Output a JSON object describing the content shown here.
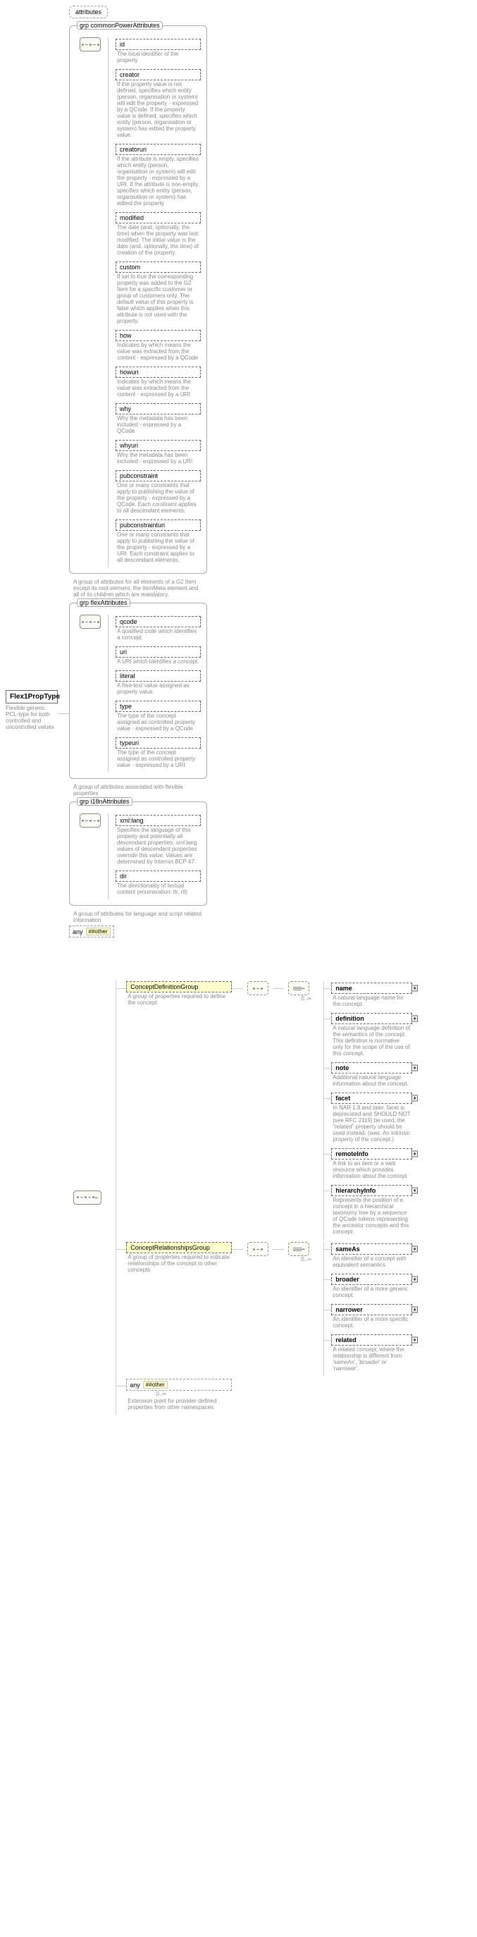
{
  "root": {
    "name": "Flex1PropType",
    "desc": "Flexible generic PCL-type for both controlled and uncontrolled values"
  },
  "attributes_label": "attributes",
  "groups": {
    "common": {
      "title": "grp commonPowerAttributes",
      "desc": "A group of attributes for all elements of a G2 Item except its root element, the itemMeta element and all of its children which are mandatory.",
      "items": [
        {
          "name": "id",
          "desc": "The local identifier of the property."
        },
        {
          "name": "creator",
          "desc": "If the property value is not defined, specifies which entity (person, organisation or system) will edit the property - expressed by a QCode. If the property value is defined, specifies which entity (person, organisation or system) has edited the property value."
        },
        {
          "name": "creatoruri",
          "desc": "If the attribute is empty, specifies which entity (person, organisation or system) will edit the property - expressed by a URI. If the attribute is non-empty, specifies which entity (person, organisation or system) has edited the property."
        },
        {
          "name": "modified",
          "desc": "The date (and, optionally, the time) when the property was last modified. The initial value is the date (and, optionally, the time) of creation of the property."
        },
        {
          "name": "custom",
          "desc": "If set to true the corresponding property was added to the G2 Item for a specific customer or group of customers only. The default value of this property is false which applies when this attribute is not used with the property."
        },
        {
          "name": "how",
          "desc": "Indicates by which means the value was extracted from the content - expressed by a QCode"
        },
        {
          "name": "howuri",
          "desc": "Indicates by which means the value was extracted from the content - expressed by a URI"
        },
        {
          "name": "why",
          "desc": "Why the metadata has been included - expressed by a QCode"
        },
        {
          "name": "whyuri",
          "desc": "Why the metadata has been included - expressed by a URI"
        },
        {
          "name": "pubconstraint",
          "desc": "One or many constraints that apply to publishing the value of the property - expressed by a QCode. Each constraint applies to all descendant elements."
        },
        {
          "name": "pubconstrainturi",
          "desc": "One or many constraints that apply to publishing the value of the property - expressed by a URI. Each constraint applies to all descendant elements."
        }
      ]
    },
    "flex": {
      "title": "grp flexAttributes",
      "desc": "A group of attributes associated with flexible properties",
      "items": [
        {
          "name": "qcode",
          "desc": "A qualified code which identifies a concept."
        },
        {
          "name": "uri",
          "desc": "A URI which identifies a concept."
        },
        {
          "name": "literal",
          "desc": "A free-text value assigned as property value."
        },
        {
          "name": "type",
          "desc": "The type of the concept assigned as controlled property value - expressed by a QCode"
        },
        {
          "name": "typeuri",
          "desc": "The type of the concept assigned as controlled property value - expressed by a URI"
        }
      ]
    },
    "i18n": {
      "title": "grp i18nAttributes",
      "desc": "A group of attributes for language and script related information",
      "items": [
        {
          "name": "xml:lang",
          "desc": "Specifies the language of this property and potentially all descendant properties. xml:lang values of descendant properties override this value. Values are determined by Internet BCP 47."
        },
        {
          "name": "dir",
          "desc": "The directionality of textual content (enumeration: ltr, rtl)"
        }
      ]
    }
  },
  "any_other": {
    "label": "any",
    "ns": "##other"
  },
  "conceptDef": {
    "title": "ConceptDefinitionGroup",
    "desc": "A group of properties required to define the concept",
    "multi": "0..∞",
    "items": [
      {
        "name": "name",
        "desc": "A natural language name for the concept."
      },
      {
        "name": "definition",
        "desc": "A natural language definition of the semantics of the concept. This definition is normative only for the scope of the use of this concept."
      },
      {
        "name": "note",
        "desc": "Additional natural language information about the concept."
      },
      {
        "name": "facet",
        "desc": "In NAR 1.8 and later, facet is deprecated and SHOULD NOT (see RFC 2119) be used, the \"related\" property should be used instead. (was: An intrinsic property of the concept.)"
      },
      {
        "name": "remoteInfo",
        "desc": "A link to an item or a web resource which provides information about the concept"
      },
      {
        "name": "hierarchyInfo",
        "desc": "Represents the position of a concept in a hierarchical taxonomy tree by a sequence of QCode tokens representing the ancestor concepts and this concept"
      }
    ]
  },
  "conceptRel": {
    "title": "ConceptRelationshipsGroup",
    "desc": "A group of properties required to indicate relationships of the concept to other concepts",
    "multi": "0..∞",
    "items": [
      {
        "name": "sameAs",
        "desc": "An identifier of a concept with equivalent semantics"
      },
      {
        "name": "broader",
        "desc": "An identifier of a more generic concept."
      },
      {
        "name": "narrower",
        "desc": "An identifier of a more specific concept."
      },
      {
        "name": "related",
        "desc": "A related concept, where the relationship is different from 'sameAs', 'broader' or 'narrower'."
      }
    ]
  },
  "anyExt": {
    "label": "any",
    "ns": "##other",
    "multi": "0..∞",
    "desc": "Extension point for provider-defined properties from other namespaces"
  },
  "chart_data": {
    "type": "tree",
    "root": "Flex1PropType",
    "attribute_groups": [
      "commonPowerAttributes",
      "flexAttributes",
      "i18nAttributes",
      "any ##other"
    ],
    "children_sequence": [
      "ConceptDefinitionGroup (0..∞ choice)",
      "ConceptRelationshipsGroup (0..∞ choice)",
      "any ##other (0..∞)"
    ],
    "conceptDefinition_choices": [
      "name",
      "definition",
      "note",
      "facet",
      "remoteInfo",
      "hierarchyInfo"
    ],
    "conceptRelationships_choices": [
      "sameAs",
      "broader",
      "narrower",
      "related"
    ]
  }
}
